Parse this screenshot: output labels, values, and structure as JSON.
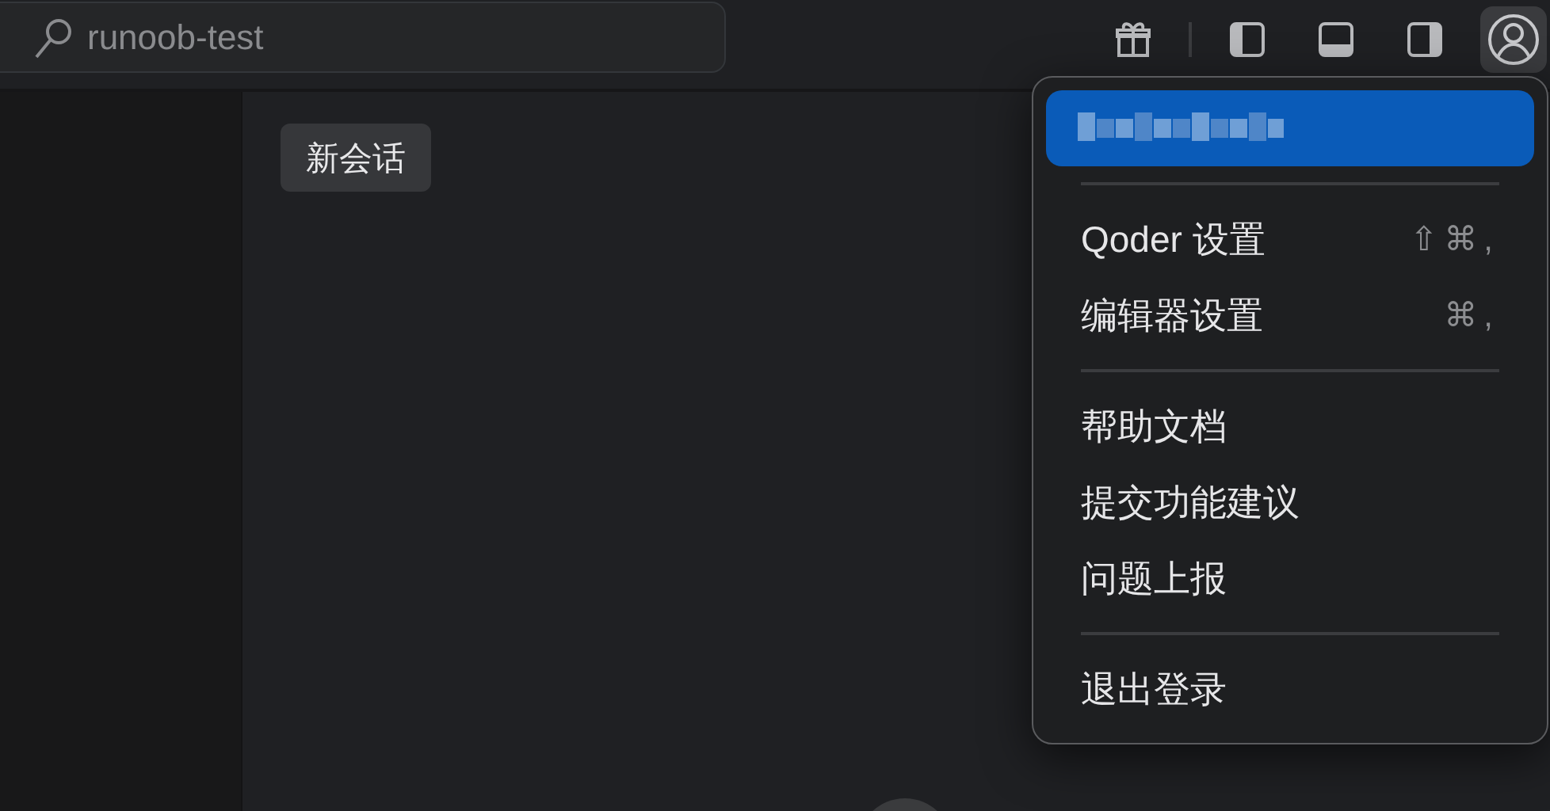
{
  "search": {
    "value": "runoob-test"
  },
  "chat_tab": {
    "label": "新会话"
  },
  "menu": [
    {
      "kind": "account",
      "selected": true
    },
    {
      "kind": "separator"
    },
    {
      "kind": "item",
      "label": "Qoder 设置",
      "shortcut": "⇧⌘,"
    },
    {
      "kind": "item",
      "label": "编辑器设置",
      "shortcut": "⌘,"
    },
    {
      "kind": "separator"
    },
    {
      "kind": "item",
      "label": "帮助文档"
    },
    {
      "kind": "item",
      "label": "提交功能建议"
    },
    {
      "kind": "item",
      "label": "问题上报"
    },
    {
      "kind": "separator"
    },
    {
      "kind": "item",
      "label": "退出登录"
    }
  ]
}
